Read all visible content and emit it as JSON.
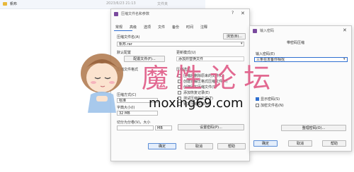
{
  "explorer": {
    "name": "帆布",
    "date": "2023/6/23 21:13",
    "type": "文件夹"
  },
  "archive_dialog": {
    "title": "压缩文件名和参数",
    "help": "?",
    "close": "✕",
    "tabs": [
      "常规",
      "高级",
      "选项",
      "文件",
      "备份",
      "时间",
      "注释"
    ],
    "archive_name_label": "压缩文件名(A)",
    "browse_button": "浏览(B)...",
    "archive_name_value": "帆布.rar",
    "default_profile_label": "默认配置",
    "profiles_button": "配置文件(F)...",
    "update_mode_label": "更新模式(U)",
    "update_mode_value": "添加并替换文件",
    "format_label": "压缩文件格式",
    "options_label": "压缩选项",
    "options": [
      "压缩后删除原来的文件(D)",
      "创建自解压格式压缩文件(X)",
      "创建固实压缩文件(S)",
      "添加恢复记录(E)",
      "测试压缩的文件(T)",
      "锁定压缩文件(L)"
    ],
    "method_label": "压缩方式(C)",
    "method_value": "标准",
    "dict_label": "字典大小(I)",
    "dict_value": "32 MB",
    "split_label": "切分为分卷(V)，大小",
    "split_value": "MB",
    "password_button": "设置密码(P)...",
    "ok_button": "确定",
    "cancel_button": "取消",
    "help_button": "帮助"
  },
  "password_dialog": {
    "title": "输入密码",
    "close": "✕",
    "header": "带密码压缩",
    "password_label": "输入密码(E)",
    "password_value": "三条狂发备你相找",
    "show_password_label": "显示密码(S)",
    "encrypt_names_label": "加密文件名(N)",
    "organize_button": "整理密码(O)...",
    "ok_button": "确定",
    "cancel_button": "取消",
    "help_button": "帮助"
  },
  "watermark": {
    "title": "魔 性 论 坛",
    "url": "moxing69.com"
  },
  "colors": {
    "accent": "#2f6fd1",
    "watermark": "#e05a86"
  }
}
